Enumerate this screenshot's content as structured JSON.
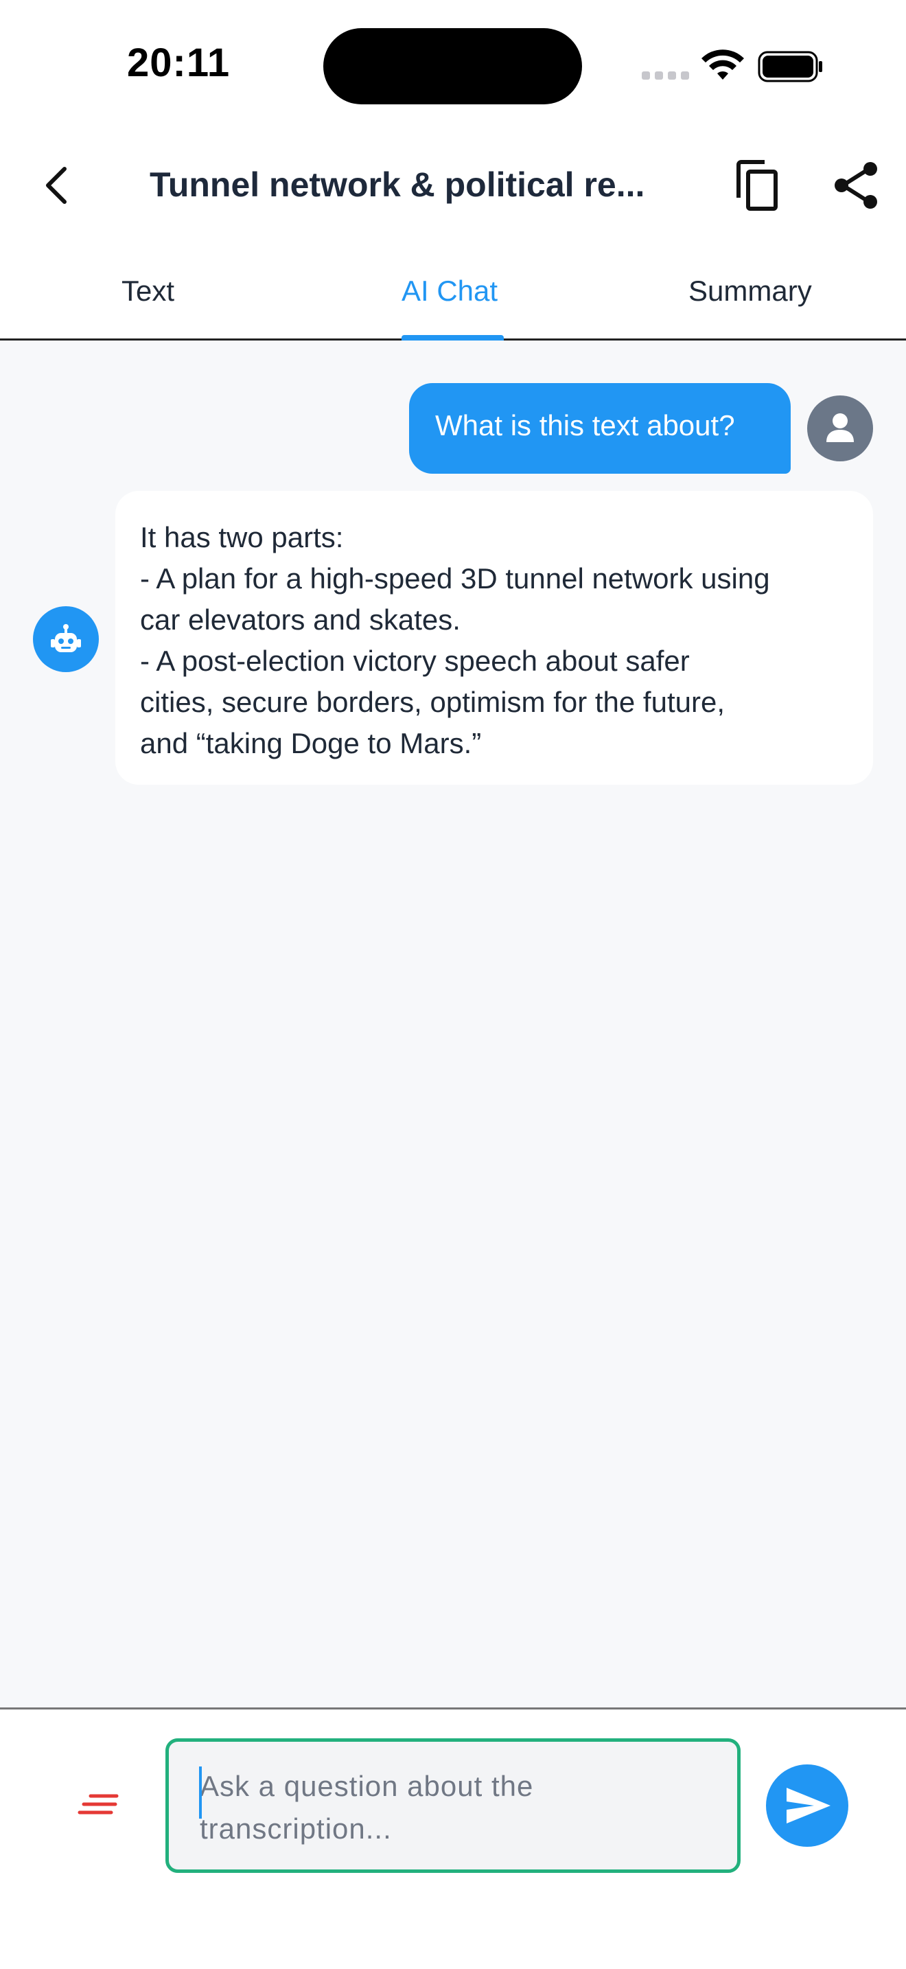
{
  "status_bar": {
    "time": "20:11"
  },
  "header": {
    "title": "Tunnel network & political re...",
    "back_icon": "chevron-left-icon",
    "copy_icon": "copy-icon",
    "share_icon": "share-icon"
  },
  "tabs": [
    {
      "label": "Text",
      "active": false
    },
    {
      "label": "AI Chat",
      "active": true
    },
    {
      "label": "Summary",
      "active": false
    }
  ],
  "chat": {
    "messages": [
      {
        "role": "user",
        "text": "What is this text about?"
      },
      {
        "role": "assistant",
        "lines": [
          "It has two parts:",
          "- A plan for a high-speed 3D tunnel network using",
          "car elevators and skates.",
          "- A post-election victory speech about safer",
          "cities, secure borders, optimism for the future,",
          "and “taking Doge to Mars.”"
        ]
      }
    ]
  },
  "composer": {
    "placeholder": "Ask a question about the transcription...",
    "value": "",
    "send_icon": "send-icon",
    "menu_icon": "lines-icon"
  },
  "colors": {
    "accent": "#2196f3",
    "input_border": "#22b07d",
    "menu_icon": "#e53935",
    "chat_background": "#f7f8fa",
    "user_avatar": "#6b7788"
  }
}
